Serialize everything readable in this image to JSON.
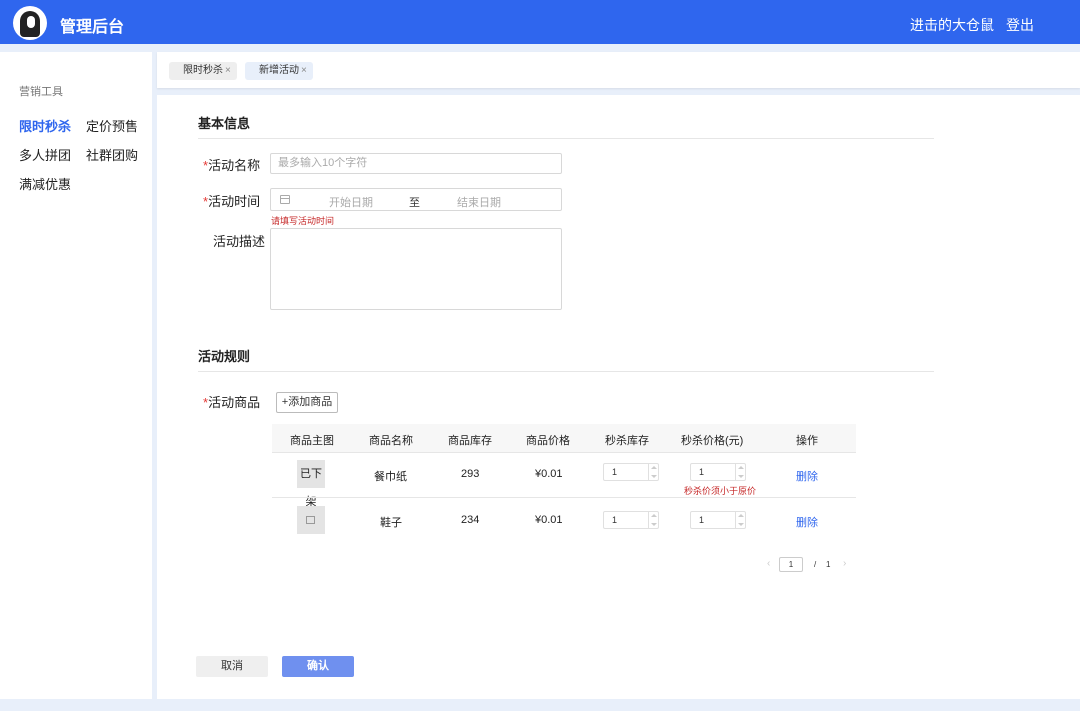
{
  "header": {
    "title": "管理后台",
    "user": "进击的大仓鼠",
    "logout": "登出"
  },
  "sidebar": {
    "group": "营销工具",
    "items": [
      "限时秒杀",
      "定价预售",
      "多人拼团",
      "社群团购",
      "满减优惠"
    ],
    "active": "限时秒杀"
  },
  "tabs": [
    {
      "label": "限时秒杀",
      "close": "×"
    },
    {
      "label": "新增活动",
      "close": "×"
    }
  ],
  "form": {
    "basic_title": "基本信息",
    "name_label": "活动名称",
    "name_placeholder": "最多输入10个字符",
    "time_label": "活动时间",
    "start_placeholder": "开始日期",
    "date_separator": "至",
    "end_placeholder": "结束日期",
    "time_error": "请填写活动时间",
    "desc_label": "活动描述",
    "rules_title": "活动规则",
    "goods_label": "活动商品",
    "add_goods": "+添加商品",
    "required_mark": "*"
  },
  "table": {
    "columns": [
      "商品主图",
      "商品名称",
      "商品库存",
      "商品价格",
      "秒杀库存",
      "秒杀价格(元)",
      "操作"
    ],
    "rows": [
      {
        "image_text": "已下架",
        "name": "餐巾纸",
        "stock": "293",
        "price": "¥0.01",
        "flash_stock": "1",
        "flash_price": "1",
        "action": "删除",
        "error": "秒杀价须小于原价"
      },
      {
        "image_text": "",
        "name": "鞋子",
        "stock": "234",
        "price": "¥0.01",
        "flash_stock": "1",
        "flash_price": "1",
        "action": "删除",
        "error": ""
      }
    ]
  },
  "pager": {
    "prev": "‹",
    "current": "1",
    "separator": "/",
    "total": "1",
    "next": "›"
  },
  "actions": {
    "cancel": "取消",
    "confirm": "确认"
  },
  "colors": {
    "primary": "#2f66ee",
    "error": "#c62828",
    "confirm_button": "#6f90ef"
  }
}
